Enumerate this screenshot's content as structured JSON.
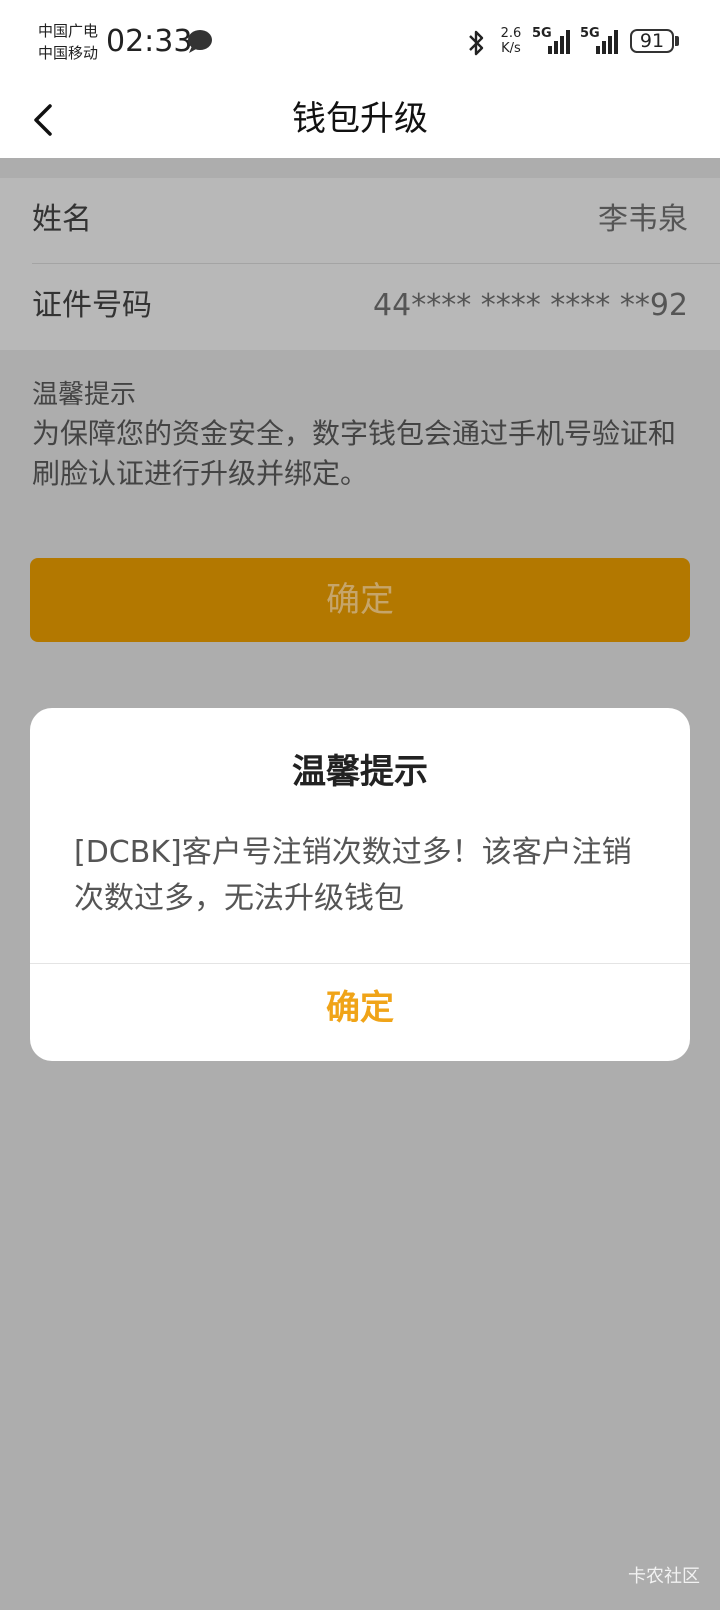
{
  "status_bar": {
    "carrier_1": "中国广电",
    "carrier_2": "中国移动",
    "time": "02:33",
    "speed_value": "2.6",
    "speed_unit": "K/s",
    "signal_1": "5G",
    "signal_2": "5G",
    "battery": "91"
  },
  "nav": {
    "title": "钱包升级"
  },
  "info": {
    "name_label": "姓名",
    "name_value": "李韦泉",
    "id_label": "证件号码",
    "id_value": "44**** **** **** **92"
  },
  "tip": {
    "title": "温馨提示",
    "body": "为保障您的资金安全，数字钱包会通过手机号验证和刷脸认证进行升级并绑定。"
  },
  "main_button": {
    "label": "确定"
  },
  "dialog": {
    "title": "温馨提示",
    "message": "[DCBK]客户号注销次数过多！该客户注销次数过多，无法升级钱包",
    "confirm_label": "确定"
  },
  "watermark": "卡农社区",
  "colors": {
    "accent": "#f0a418",
    "button_dimmed": "#b37800",
    "overlay": "#adadad"
  }
}
